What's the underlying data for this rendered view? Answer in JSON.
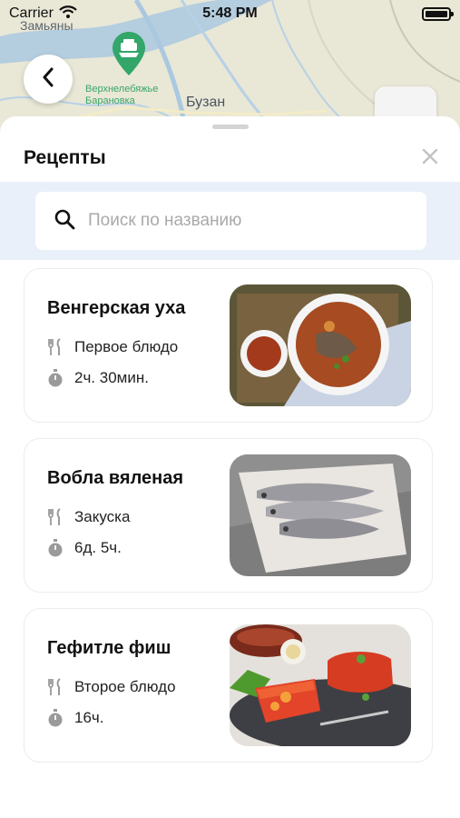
{
  "status_bar": {
    "carrier": "Carrier",
    "time": "5:48 PM"
  },
  "map": {
    "labels": {
      "village_top": "Замьяны",
      "village_green": "Верхнелебяжье\nБарановка",
      "city": "Бузан"
    },
    "colors": {
      "land": "#e9e7d6",
      "water": "#aac8e0",
      "pin": "#33a66a"
    }
  },
  "sheet": {
    "title": "Рецепты",
    "search": {
      "placeholder": "Поиск по названию",
      "value": ""
    }
  },
  "recipes": [
    {
      "title": "Венгерская уха",
      "category": "Первое блюдо",
      "duration": "2ч. 30мин.",
      "image_icon": "fish-soup-photo"
    },
    {
      "title": "Вобла вяленая",
      "category": "Закуска",
      "duration": "6д. 5ч.",
      "image_icon": "dried-fish-photo"
    },
    {
      "title": "Гефитле фиш",
      "category": "Второе блюдо",
      "duration": "16ч.",
      "image_icon": "fish-aspic-photo"
    }
  ],
  "colors": {
    "accent_band": "#e9f0f9",
    "card_border": "#ececec",
    "icon_gray": "#9a9a9a"
  }
}
